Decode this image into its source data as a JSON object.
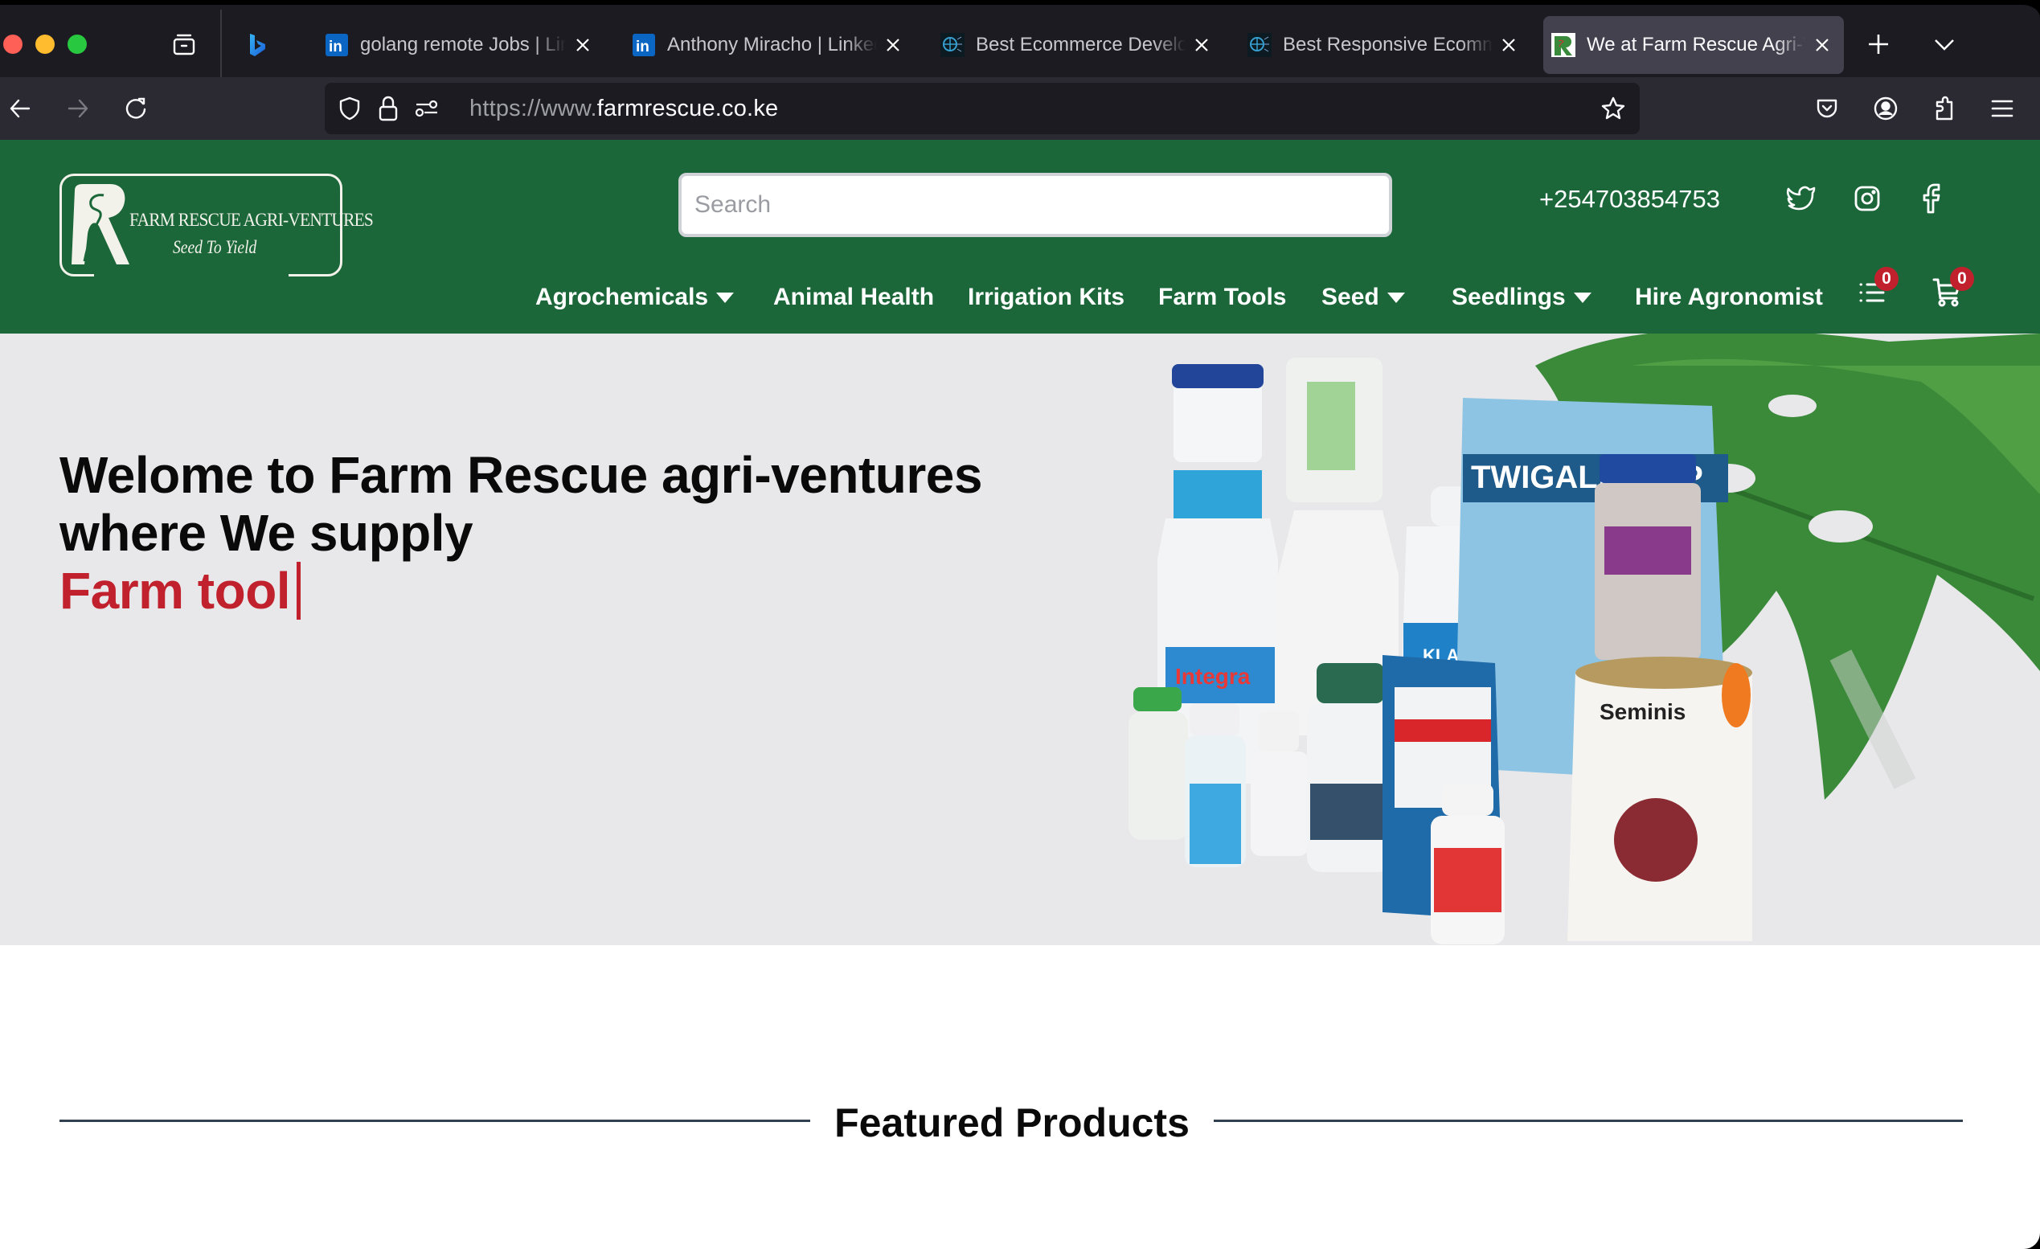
{
  "browser": {
    "tabs": [
      {
        "favicon": "linkedin-icon",
        "title": "golang remote Jobs | LinkedIn",
        "active": false
      },
      {
        "favicon": "linkedin-icon",
        "title": "Anthony Miracho | LinkedIn",
        "active": false
      },
      {
        "favicon": "globe-brand-icon",
        "title": "Best Ecommerce Developer",
        "active": false
      },
      {
        "favicon": "globe-brand-icon",
        "title": "Best Responsive Ecommerce",
        "active": false
      },
      {
        "favicon": "farm-rescue-icon",
        "title": "We at Farm Rescue Agri-Ventures",
        "active": true
      }
    ],
    "url_prefix": "https://www.",
    "url_domain": "farmrescue.co.ke",
    "icons": {
      "tab_overview": "tab-overview-icon",
      "bing": "bing-icon",
      "new_tab": "plus-icon",
      "list_tabs": "chevron-down-icon",
      "back": "arrow-left-icon",
      "forward": "arrow-right-icon",
      "reload": "reload-icon",
      "shield": "shield-icon",
      "lock": "lock-icon",
      "permissions": "permissions-icon",
      "bookmark": "star-icon",
      "pocket": "pocket-icon",
      "account": "account-icon",
      "extensions": "puzzle-icon",
      "menu": "hamburger-icon"
    }
  },
  "site": {
    "brand_color": "#1c673a",
    "accent_color": "#c1212d",
    "logo": {
      "name": "FARM RESCUE AGRI-VENTURES",
      "tagline": "Seed To Yield"
    },
    "search_placeholder": "Search",
    "phone": "+254703854753",
    "social": [
      "twitter-icon",
      "instagram-icon",
      "facebook-icon"
    ],
    "nav": [
      {
        "label": "Agrochemicals",
        "dropdown": true
      },
      {
        "label": "Animal Health",
        "dropdown": false
      },
      {
        "label": "Irrigation Kits",
        "dropdown": false
      },
      {
        "label": "Farm Tools",
        "dropdown": false
      },
      {
        "label": "Seed",
        "dropdown": true
      },
      {
        "label": "Seedlings",
        "dropdown": true
      },
      {
        "label": "Hire Agronomist",
        "dropdown": false
      }
    ],
    "wishlist_count": "0",
    "cart_count": "0"
  },
  "hero": {
    "heading_line1": "Welome to Farm Rescue agri-ventures",
    "heading_line2": "where We supply",
    "typed_text": "Farm tool",
    "image_alt": "Agrochemical products: Integra, Klassic 5% EC, Twigalax WP, Seminis seed can, with monstera leaf"
  },
  "featured": {
    "title": "Featured Products"
  }
}
